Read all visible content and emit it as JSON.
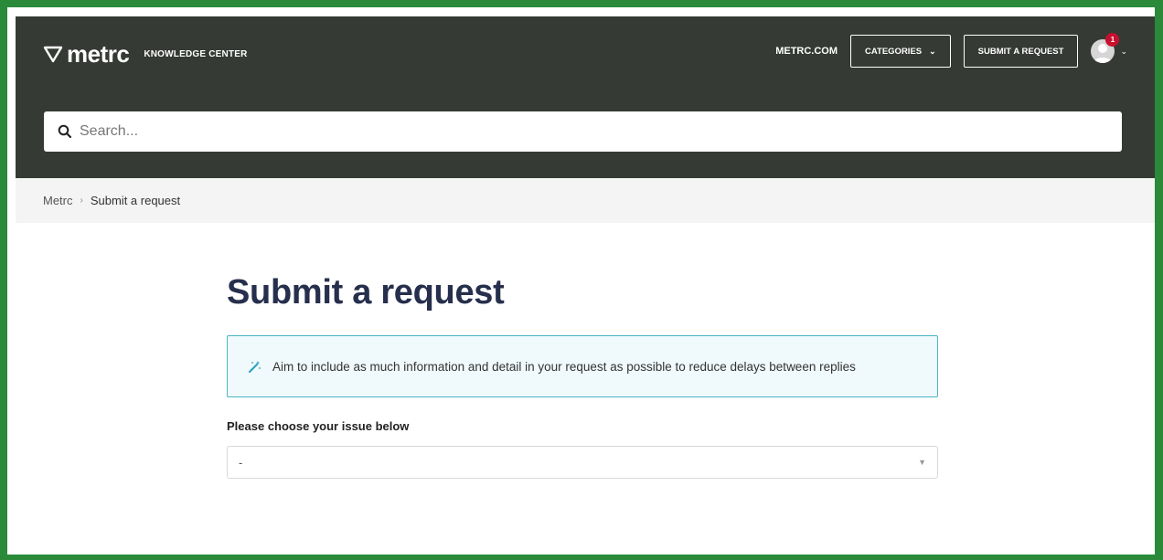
{
  "header": {
    "brand": "metrc",
    "subtitle": "KNOWLEDGE CENTER",
    "nav": {
      "site_link": "METRC.COM",
      "categories": "CATEGORIES",
      "submit_request": "SUBMIT A REQUEST"
    },
    "notification_count": "1"
  },
  "search": {
    "placeholder": "Search..."
  },
  "breadcrumb": {
    "root": "Metrc",
    "current": "Submit a request"
  },
  "main": {
    "title": "Submit a request",
    "notice": "Aim to include as much information and detail in your request as possible to reduce delays between replies",
    "issue_label": "Please choose your issue below",
    "issue_selected": "-"
  },
  "colors": {
    "header_bg": "#353a34",
    "title": "#262f4c",
    "notice_border": "#4bb5c9",
    "notice_bg": "#f0f9fb",
    "badge": "#c8102e"
  },
  "icons": [
    "metrc-logo-icon",
    "chevron-down-icon",
    "user-avatar-icon",
    "search-icon",
    "magic-wand-icon",
    "caret-down-icon"
  ]
}
